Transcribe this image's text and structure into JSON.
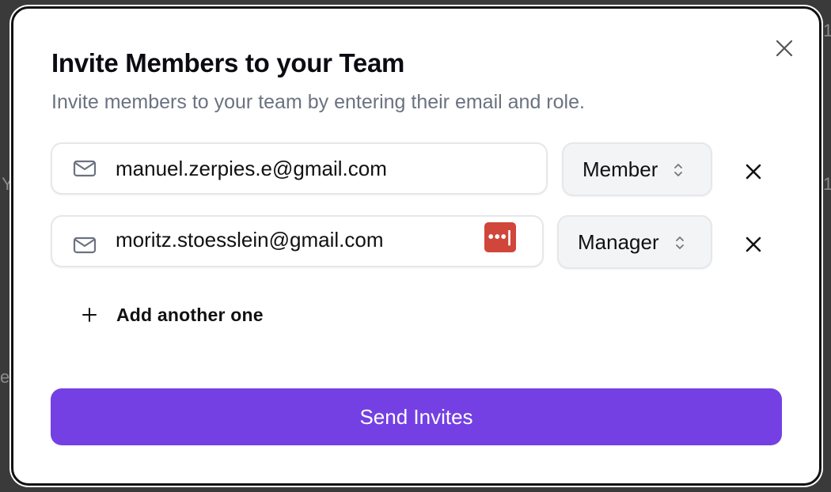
{
  "modal": {
    "title": "Invite Members to your Team",
    "subtitle": "Invite members to your team by entering their email and role."
  },
  "invites": [
    {
      "email": "manuel.zerpies.e@gmail.com",
      "role": "Member"
    },
    {
      "email": "moritz.stoesslein@gmail.com",
      "role": "Manager"
    }
  ],
  "password_manager_badge": "•••|",
  "add_another_label": "Add another one",
  "send_button_label": "Send Invites",
  "colors": {
    "accent": "#7440e3",
    "password_badge": "#d0463b",
    "subtitle_text": "#6b7280"
  }
}
